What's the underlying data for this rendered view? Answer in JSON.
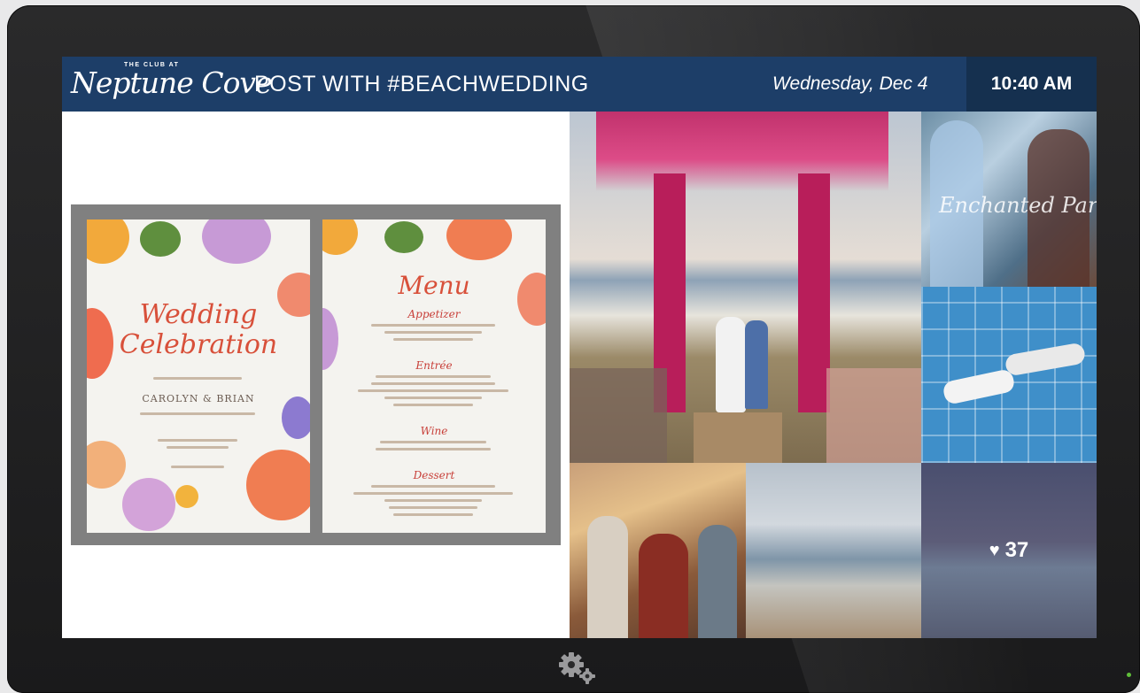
{
  "header": {
    "logo_small": "THE CLUB AT",
    "logo_script": "Neptune Cove",
    "hashtag": "POST WITH #BEACHWEDDING",
    "date": "Wednesday, Dec 4",
    "time": "10:40 AM"
  },
  "invite_card": {
    "title_line1": "Wedding",
    "title_line2": "Celebration",
    "names": "CAROLYN & BRIAN"
  },
  "menu_card": {
    "title": "Menu",
    "sections": [
      "Appetizer",
      "Entrée",
      "Wine",
      "Dessert"
    ]
  },
  "photo_overlay_text": "Enchanted Parties",
  "likes": {
    "count": "37"
  },
  "colors": {
    "header_bg": "#1d3e68",
    "clock_bg": "#15304f",
    "accent_script": "#d8503a"
  },
  "icons": {
    "settings": "gear-icon",
    "likes": "heart-icon"
  }
}
